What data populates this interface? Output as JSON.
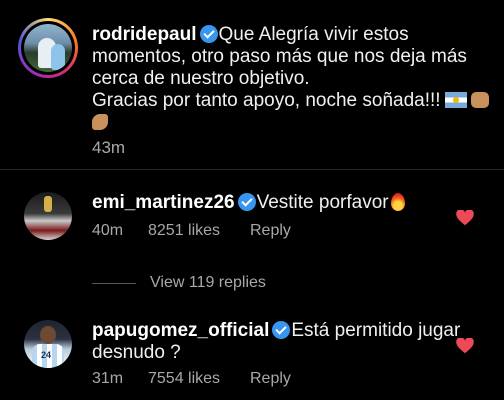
{
  "post": {
    "username": "rodridepaul",
    "caption": "Que Alegría vivir estos momentos, otro paso más que nos deja más cerca de nuestro objetivo.",
    "caption_line2": "Gracias por tanto apoyo, noche soñada!!!",
    "time": "43m"
  },
  "comments": [
    {
      "username": "emi_martinez26",
      "text": "Vestite porfavor",
      "time": "40m",
      "likes": "8251 likes",
      "reply_label": "Reply"
    },
    {
      "username": "papugomez_official",
      "text": "Está permitido jugar desnudo ?",
      "time": "31m",
      "likes": "7554 likes",
      "reply_label": "Reply",
      "jersey_number": "24"
    }
  ],
  "view_replies": "View 119 replies",
  "colors": {
    "background": "#000000",
    "verified": "#3797f0",
    "like_heart": "#ed4956",
    "secondary_text": "#a8a8a8"
  }
}
